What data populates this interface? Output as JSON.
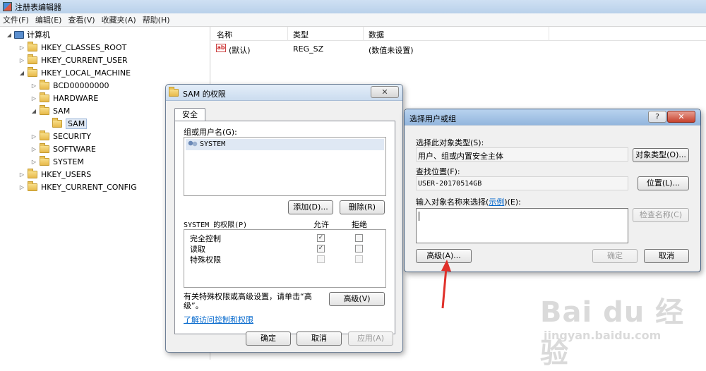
{
  "main_window": {
    "title": "注册表编辑器",
    "menu": [
      "文件(F)",
      "编辑(E)",
      "查看(V)",
      "收藏夹(A)",
      "帮助(H)"
    ]
  },
  "tree": {
    "computer": "计算机",
    "hkcr": "HKEY_CLASSES_ROOT",
    "hkcu": "HKEY_CURRENT_USER",
    "hklm": "HKEY_LOCAL_MACHINE",
    "bcd": "BCD00000000",
    "hardware": "HARDWARE",
    "sam": "SAM",
    "sam_child": "SAM",
    "security": "SECURITY",
    "software": "SOFTWARE",
    "system": "SYSTEM",
    "hku": "HKEY_USERS",
    "hkcc": "HKEY_CURRENT_CONFIG"
  },
  "list": {
    "headers": {
      "name": "名称",
      "type": "类型",
      "data": "数据"
    },
    "rows": [
      {
        "name": "(默认)",
        "type": "REG_SZ",
        "data": "(数值未设置)"
      }
    ],
    "value_icon_text": "ab"
  },
  "perm_dialog": {
    "title": "SAM 的权限",
    "tab": "安全",
    "group_label": "组或用户名(G):",
    "users": [
      "SYSTEM"
    ],
    "add_button": "添加(D)...",
    "remove_button": "删除(R)",
    "perm_label": "SYSTEM 的权限(P)",
    "allow_header": "允许",
    "deny_header": "拒绝",
    "permissions": [
      {
        "name": "完全控制",
        "allow": true,
        "deny": false
      },
      {
        "name": "读取",
        "allow": true,
        "deny": false
      },
      {
        "name": "特殊权限",
        "allow": false,
        "deny": false
      }
    ],
    "note_line1": "有关特殊权限或高级设置，请单击“高",
    "note_line2": "级”。",
    "advanced_button": "高级(V)",
    "link": "了解访问控制和权限",
    "ok_button": "确定",
    "cancel_button": "取消",
    "apply_button": "应用(A)",
    "close_symbol": "✕"
  },
  "select_dialog": {
    "title": "选择用户或组",
    "help_symbol": "?",
    "close_symbol": "✕",
    "obj_type_label": "选择此对象类型(S):",
    "obj_type_value": "用户、组或内置安全主体",
    "obj_type_button": "对象类型(O)...",
    "location_label": "查找位置(F):",
    "location_value": "USER-20170514GB",
    "location_button": "位置(L)...",
    "enter_label_prefix": "输入对象名称来选择(",
    "enter_label_link": "示例",
    "enter_label_suffix": ")(E):",
    "check_names_button": "检查名称(C)",
    "advanced_button": "高级(A)...",
    "ok_button": "确定",
    "cancel_button": "取消"
  },
  "watermark": {
    "logo": "Bai du 经验",
    "url": "jingyan.baidu.com"
  },
  "colors": {
    "arrow": "#e0302a",
    "link": "#0066cc",
    "close": "#c7422d"
  }
}
